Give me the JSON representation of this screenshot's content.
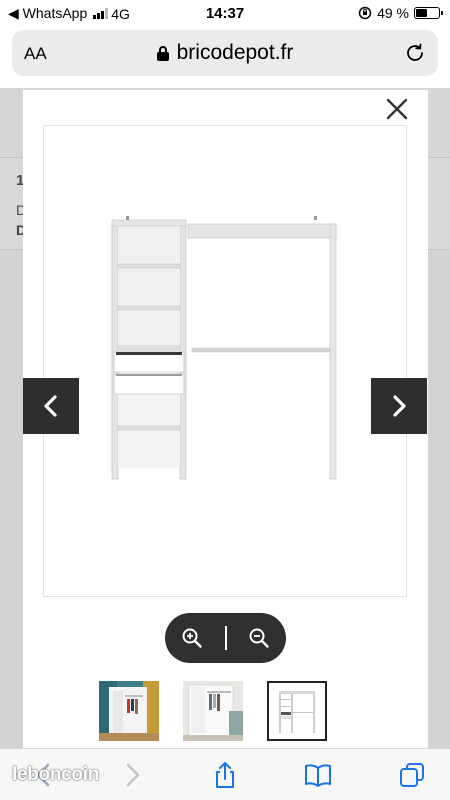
{
  "status_bar": {
    "carrier_back": "◀ WhatsApp",
    "network": "4G",
    "time": "14:37",
    "battery_percent": "49 %",
    "battery_level": 0.49
  },
  "browser": {
    "text_size_label": "AA",
    "url": "bricodepot.fr"
  },
  "background_page": {
    "fragments": [
      "1",
      "D",
      "D"
    ]
  },
  "gallery": {
    "thumbnails": [
      {
        "name": "dressing-colorful-room"
      },
      {
        "name": "dressing-white-room"
      },
      {
        "name": "dressing-white-background",
        "selected": true
      }
    ]
  },
  "watermark": "leboncoin",
  "colors": {
    "overlay": "#d3d3d3",
    "dark_control": "#2e2e2e",
    "toolbar_icon": "#1a73e8"
  }
}
